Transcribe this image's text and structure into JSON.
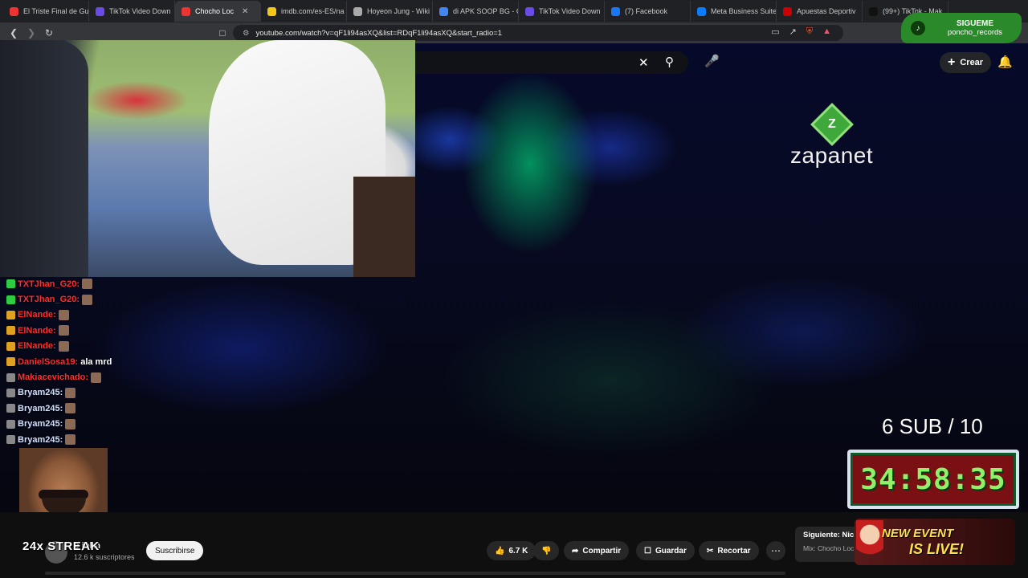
{
  "browser": {
    "tabs": [
      {
        "label": "El Triste Final de Gu",
        "color": "#e33",
        "active": false
      },
      {
        "label": "TikTok Video Down",
        "color": "#6b4be8",
        "active": false
      },
      {
        "label": "Chocho Loc",
        "color": "#e33",
        "active": true
      },
      {
        "label": "imdb.com/es-ES/na",
        "color": "#f5c518",
        "active": false
      },
      {
        "label": "Hoyeon Jung - Wiki",
        "color": "#aaa",
        "active": false
      },
      {
        "label": "di APK SOOP BG - G",
        "color": "#4285f4",
        "active": false
      },
      {
        "label": "TikTok Video Down",
        "color": "#6b4be8",
        "active": false
      },
      {
        "label": "(7) Facebook",
        "color": "#1877f2",
        "active": false
      },
      {
        "label": "Meta Business Suite",
        "color": "#0a7cff",
        "active": false
      },
      {
        "label": "Apuestas Deportiv",
        "color": "#c00",
        "active": false
      },
      {
        "label": "(99+) TikTok - Mak",
        "color": "#111",
        "active": false
      }
    ],
    "url": "youtube.com/watch?v=qF1li94asXQ&list=RDqF1li94asXQ&start_radio=1"
  },
  "youtube": {
    "create_label": "Crear",
    "channel_name": "o john",
    "channel_subs": "12.6 k suscriptores",
    "subscribe_label": "Suscribirse",
    "likes": "6.7 K",
    "share_label": "Compartir",
    "save_label": "Guardar",
    "clip_label": "Recortar",
    "next_title": "Siguiente: Nic",
    "next_sub": "Mix: Chocho Loc"
  },
  "video_overlay": {
    "brand": "zapanet",
    "brand_initial": "Z"
  },
  "stream": {
    "follow_title": "SIGUEME",
    "follow_handle": "poncho_records",
    "sub_goal": "6 SUB / 10",
    "timer": "34:58:35",
    "streak": "24x STREAK",
    "event_line1": "NEW EVENT",
    "event_line2": "IS LIVE!",
    "chat": [
      {
        "user": "TXTJhan_G20:",
        "color": "#ff2d2d",
        "msg": ""
      },
      {
        "user": "TXTJhan_G20:",
        "color": "#ff2d2d",
        "msg": ""
      },
      {
        "user": "ElNande:",
        "color": "#ff2d2d",
        "msg": ""
      },
      {
        "user": "ElNande:",
        "color": "#ff2d2d",
        "msg": ""
      },
      {
        "user": "ElNande:",
        "color": "#ff2d2d",
        "msg": ""
      },
      {
        "user": "DanielSosa19:",
        "color": "#ff2d2d",
        "msg": "ala mrd"
      },
      {
        "user": "Makiacevichado:",
        "color": "#ff2d2d",
        "msg": ""
      },
      {
        "user": "Bryam245:",
        "color": "#cfe0ff",
        "msg": ""
      },
      {
        "user": "Bryam245:",
        "color": "#cfe0ff",
        "msg": ""
      },
      {
        "user": "Bryam245:",
        "color": "#cfe0ff",
        "msg": ""
      },
      {
        "user": "Bryam245:",
        "color": "#cfe0ff",
        "msg": ""
      }
    ]
  }
}
